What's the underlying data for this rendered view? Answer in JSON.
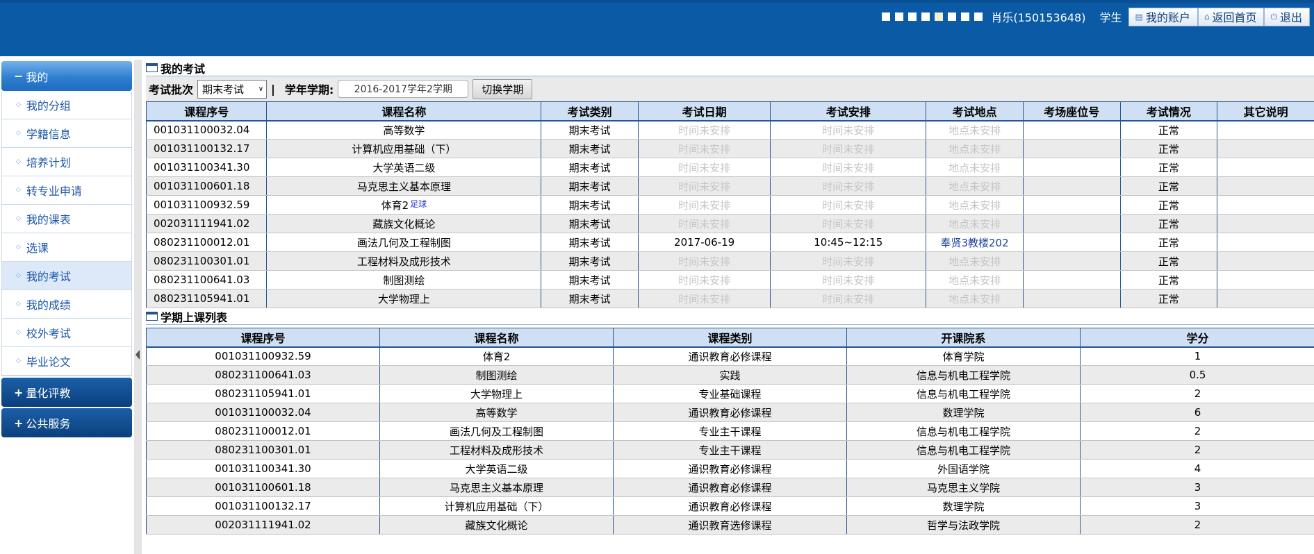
{
  "header": {
    "user": "肖乐(150153648)",
    "role": "学生",
    "buttons": {
      "account": "我的账户",
      "home": "返回首页",
      "logout": "退出"
    }
  },
  "sidebar": {
    "group_my": "我的",
    "items": [
      "我的分组",
      "学籍信息",
      "培养计划",
      "转专业申请",
      "我的课表",
      "选课",
      "我的考试",
      "我的成绩",
      "校外考试",
      "毕业论文"
    ],
    "selected_index": 6,
    "group_quant": "量化评教",
    "group_public": "公共服务"
  },
  "exam": {
    "title": "我的考试",
    "batch_label": "考试批次",
    "batch_value": "期末考试",
    "separator": "|",
    "term_label": "学年学期:",
    "term_value": "2016-2017学年2学期",
    "switch_button": "切换学期",
    "headers": [
      "课程序号",
      "课程名称",
      "考试类别",
      "考试日期",
      "考试安排",
      "考试地点",
      "考场座位号",
      "考试情况",
      "其它说明"
    ],
    "rows": [
      {
        "code": "001031100032.04",
        "name": "高等数学",
        "tag": "",
        "type": "期末考试",
        "date": "时间未安排",
        "time": "时间未安排",
        "place": "地点未安排",
        "seat": "",
        "status": "正常",
        "note": "",
        "scheduled": false
      },
      {
        "code": "001031100132.17",
        "name": "计算机应用基础（下）",
        "tag": "",
        "type": "期末考试",
        "date": "时间未安排",
        "time": "时间未安排",
        "place": "地点未安排",
        "seat": "",
        "status": "正常",
        "note": "",
        "scheduled": false
      },
      {
        "code": "001031100341.30",
        "name": "大学英语二级",
        "tag": "",
        "type": "期末考试",
        "date": "时间未安排",
        "time": "时间未安排",
        "place": "地点未安排",
        "seat": "",
        "status": "正常",
        "note": "",
        "scheduled": false
      },
      {
        "code": "001031100601.18",
        "name": "马克思主义基本原理",
        "tag": "",
        "type": "期末考试",
        "date": "时间未安排",
        "time": "时间未安排",
        "place": "地点未安排",
        "seat": "",
        "status": "正常",
        "note": "",
        "scheduled": false
      },
      {
        "code": "001031100932.59",
        "name": "体育2",
        "tag": "足球",
        "type": "期末考试",
        "date": "时间未安排",
        "time": "时间未安排",
        "place": "地点未安排",
        "seat": "",
        "status": "正常",
        "note": "",
        "scheduled": false
      },
      {
        "code": "002031111941.02",
        "name": "藏族文化概论",
        "tag": "",
        "type": "期末考试",
        "date": "时间未安排",
        "time": "时间未安排",
        "place": "地点未安排",
        "seat": "",
        "status": "正常",
        "note": "",
        "scheduled": false
      },
      {
        "code": "080231100012.01",
        "name": "画法几何及工程制图",
        "tag": "",
        "type": "期末考试",
        "date": "2017-06-19",
        "time": "10:45~12:15",
        "place": "奉贤3教楼202",
        "seat": "",
        "status": "正常",
        "note": "",
        "scheduled": true
      },
      {
        "code": "080231100301.01",
        "name": "工程材料及成形技术",
        "tag": "",
        "type": "期末考试",
        "date": "时间未安排",
        "time": "时间未安排",
        "place": "地点未安排",
        "seat": "",
        "status": "正常",
        "note": "",
        "scheduled": false
      },
      {
        "code": "080231100641.03",
        "name": "制图测绘",
        "tag": "",
        "type": "期末考试",
        "date": "时间未安排",
        "time": "时间未安排",
        "place": "地点未安排",
        "seat": "",
        "status": "正常",
        "note": "",
        "scheduled": false
      },
      {
        "code": "080231105941.01",
        "name": "大学物理上",
        "tag": "",
        "type": "期末考试",
        "date": "时间未安排",
        "time": "时间未安排",
        "place": "地点未安排",
        "seat": "",
        "status": "正常",
        "note": "",
        "scheduled": false
      }
    ]
  },
  "courses": {
    "title": "学期上课列表",
    "headers": [
      "课程序号",
      "课程名称",
      "课程类别",
      "开课院系",
      "学分"
    ],
    "rows": [
      {
        "code": "001031100932.59",
        "name": "体育2",
        "category": "通识教育必修课程",
        "dept": "体育学院",
        "credit": "1"
      },
      {
        "code": "080231100641.03",
        "name": "制图测绘",
        "category": "实践",
        "dept": "信息与机电工程学院",
        "credit": "0.5"
      },
      {
        "code": "080231105941.01",
        "name": "大学物理上",
        "category": "专业基础课程",
        "dept": "信息与机电工程学院",
        "credit": "2"
      },
      {
        "code": "001031100032.04",
        "name": "高等数学",
        "category": "通识教育必修课程",
        "dept": "数理学院",
        "credit": "6"
      },
      {
        "code": "080231100012.01",
        "name": "画法几何及工程制图",
        "category": "专业主干课程",
        "dept": "信息与机电工程学院",
        "credit": "2"
      },
      {
        "code": "080231100301.01",
        "name": "工程材料及成形技术",
        "category": "专业主干课程",
        "dept": "信息与机电工程学院",
        "credit": "2"
      },
      {
        "code": "001031100341.30",
        "name": "大学英语二级",
        "category": "通识教育必修课程",
        "dept": "外国语学院",
        "credit": "4"
      },
      {
        "code": "001031100601.18",
        "name": "马克思主义基本原理",
        "category": "通识教育必修课程",
        "dept": "马克思主义学院",
        "credit": "3"
      },
      {
        "code": "001031100132.17",
        "name": "计算机应用基础（下）",
        "category": "通识教育必修课程",
        "dept": "数理学院",
        "credit": "3"
      },
      {
        "code": "002031111941.02",
        "name": "藏族文化概论",
        "category": "通识教育选修课程",
        "dept": "哲学与法政学院",
        "credit": "2"
      }
    ]
  }
}
